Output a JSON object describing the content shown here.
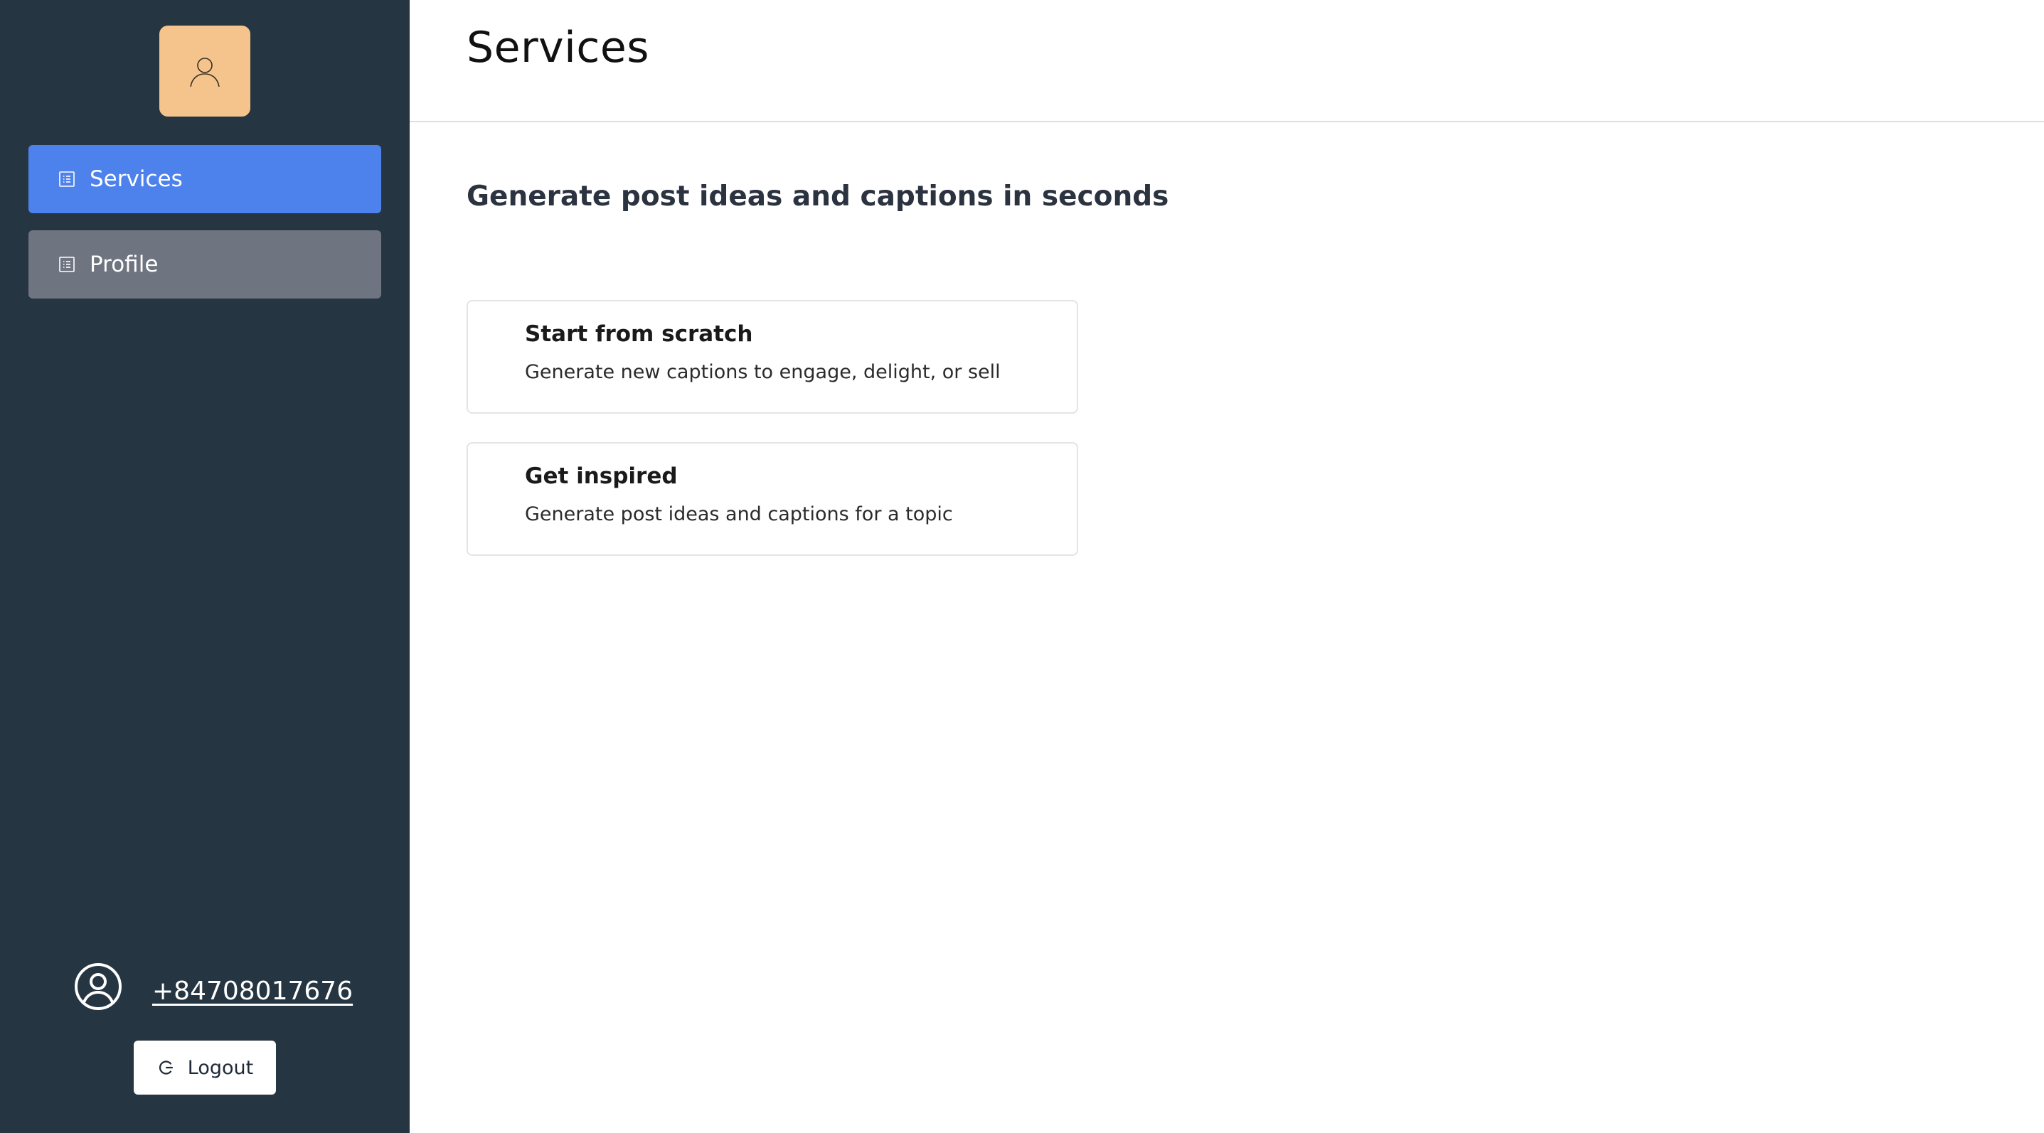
{
  "sidebar": {
    "avatar_icon": "user-icon",
    "items": [
      {
        "label": "Services",
        "icon": "list-icon",
        "active": true
      },
      {
        "label": "Profile",
        "icon": "list-icon",
        "active": false
      }
    ],
    "user": {
      "icon": "user-circle-icon",
      "phone": "+84708017676"
    },
    "logout": {
      "label": "Logout",
      "icon": "logout-icon"
    }
  },
  "header": {
    "title": "Services"
  },
  "main": {
    "subtitle": "Generate post ideas and captions in seconds",
    "cards": [
      {
        "title": "Start from scratch",
        "description": "Generate new captions to engage, delight, or sell"
      },
      {
        "title": "Get inspired",
        "description": "Generate post ideas and captions for a topic"
      }
    ]
  },
  "colors": {
    "sidebar_bg": "#263542",
    "active_item": "#4d82ed",
    "inactive_item": "#6e7480",
    "avatar_bg": "#f5c48c"
  }
}
